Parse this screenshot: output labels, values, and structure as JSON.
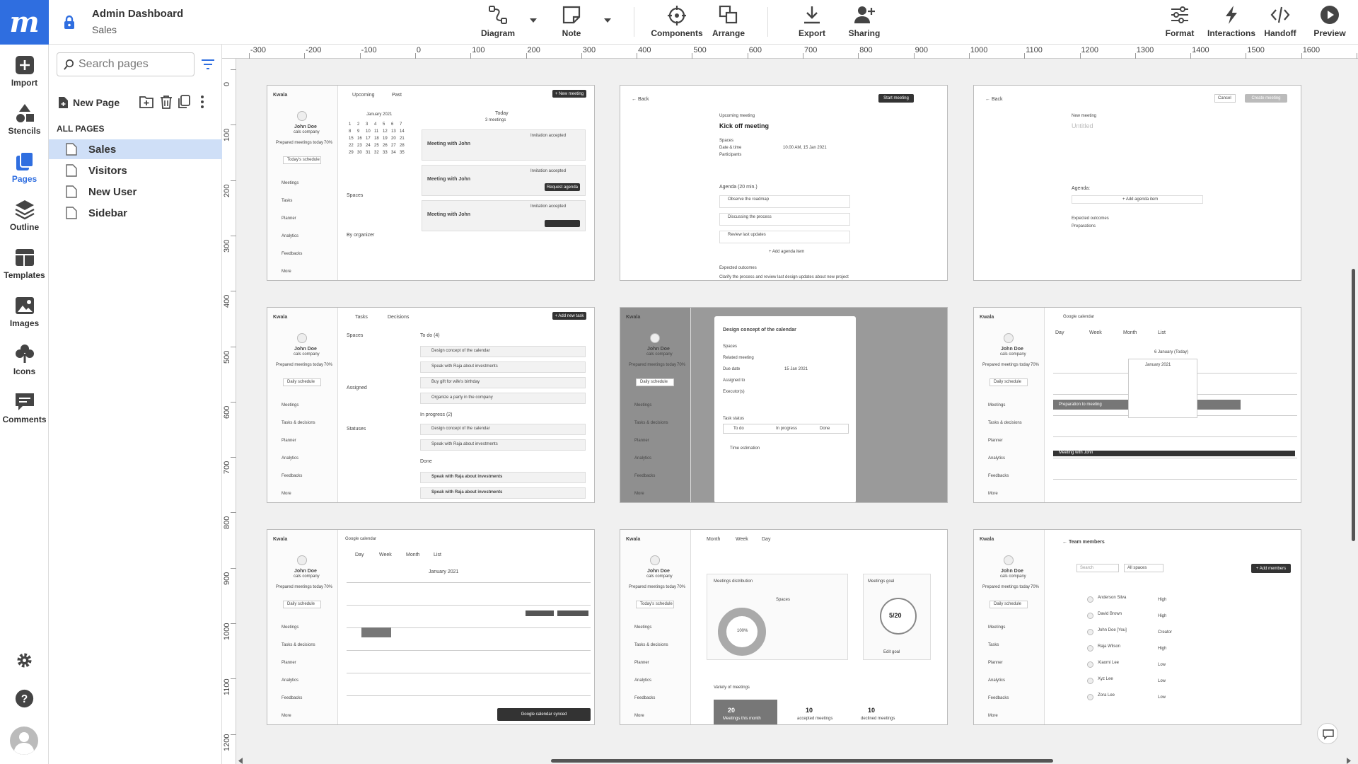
{
  "header": {
    "title": "Admin Dashboard",
    "subtitle": "Sales"
  },
  "toolbar": {
    "diagram": "Diagram",
    "note": "Note",
    "components": "Components",
    "arrange": "Arrange",
    "export": "Export",
    "sharing": "Sharing",
    "format": "Format",
    "interactions": "Interactions",
    "handoff": "Handoff",
    "preview": "Preview"
  },
  "rail": {
    "import": "Import",
    "stencils": "Stencils",
    "pages": "Pages",
    "outline": "Outline",
    "templates": "Templates",
    "images": "Images",
    "icons": "Icons",
    "comments": "Comments"
  },
  "panel": {
    "search_placeholder": "Search pages",
    "new_page": "New Page",
    "all_pages": "ALL PAGES",
    "pages": [
      "Sales",
      "Visitors",
      "New User",
      "Sidebar"
    ]
  },
  "ruler": {
    "h": [
      "-300",
      "-200",
      "-100",
      "0",
      "100",
      "200",
      "300",
      "400",
      "500",
      "600",
      "700",
      "800",
      "900",
      "1000",
      "1100",
      "1200",
      "1300",
      "1400",
      "1500",
      "1600",
      "1700"
    ],
    "v": [
      "0",
      "100",
      "200",
      "300",
      "400",
      "500",
      "600",
      "700",
      "800",
      "900",
      "1000",
      "1100",
      "1200"
    ]
  },
  "thumbs": {
    "app": "Kwala",
    "user": "John Doe",
    "company": "cals company",
    "prep": "Prepared meetings today",
    "pct": "70%",
    "today_sched": "Today's schedule",
    "daily_sched": "Daily schedule",
    "nav": [
      "Meetings",
      "Tasks",
      "Planner",
      "Analytics",
      "Feedbacks",
      "More"
    ],
    "nav2": [
      "Meetings",
      "Tasks & decisions",
      "Planner",
      "Analytics",
      "Feedbacks",
      "More"
    ],
    "t1": {
      "tab1": "Upcoming",
      "tab2": "Past",
      "btn": "+ New meeting",
      "month": "January 2021",
      "today": "Today",
      "count": "3 meetings",
      "spaces": "Spaces",
      "organizer": "By organizer",
      "m1": "Meeting with John",
      "m2": "Meeting with John",
      "m3": "Meeting with John",
      "req": "Request agenda",
      "acc": "Invitation accepted"
    },
    "t2": {
      "back": "Back",
      "start": "Start meeting",
      "upcoming": "Upcoming meeting",
      "title": "Kick off meeting",
      "spaces": "Spaces",
      "date": "Date & time",
      "date_val": "10.00 AM, 15 Jan 2021",
      "part": "Participants",
      "agenda": "Agenda (20 min.)",
      "a1": "Observe the roadmap",
      "a2": "Discussing the process",
      "a3": "Review last updates",
      "add": "+ Add agenda item",
      "exp": "Expected outcomes",
      "clar": "Clarify the process and review last design updates about new project"
    },
    "t3": {
      "back": "Back",
      "cancel": "Cancel",
      "create": "Create meeting",
      "new": "New meeting",
      "untitled": "Untitled",
      "agenda": "Agenda:",
      "add": "+ Add agenda item",
      "exp": "Expected outcomes",
      "prep": "Preparations"
    },
    "t4": {
      "tab1": "Tasks",
      "tab2": "Decisions",
      "btn": "+ Add new task",
      "todo": "To do (4)",
      "inprog": "In progress (2)",
      "done": "Done",
      "tasks": [
        "Design concept of the calendar",
        "Speak with Raja about investments",
        "Buy gift for wife's birthday",
        "Organize a party in the company"
      ],
      "prog": [
        "Design concept of the calendar",
        "Speak with Raja about investments"
      ],
      "dtasks": [
        "Speak with Raja about investments",
        "Speak with Raja about investments"
      ],
      "assigned": "Assigned",
      "statuses": "Statuses"
    },
    "t5": {
      "modal": "Design concept of the calendar",
      "spaces": "Spaces",
      "rel": "Related meeting",
      "due": "Due date",
      "due_val": "15 Jan 2021",
      "assn": "Assigned to",
      "exec": "Executor(s)",
      "status": "Task status",
      "s1": "To do",
      "s2": "In progress",
      "s3": "Done",
      "est": "Time estimation"
    },
    "t6": {
      "title": "Google calendar",
      "day": "Day",
      "week": "Week",
      "month": "Month",
      "list": "List",
      "date": "6 January (Today)",
      "cal_month": "January 2021",
      "ev1": "Preparation to meeting",
      "ev2": "Meeting with John"
    },
    "t7": {
      "title": "Google calendar",
      "day": "Day",
      "week": "Week",
      "month": "Month",
      "list": "List",
      "cal_month": "January 2021",
      "sync": "Google calendar synced"
    },
    "t8": {
      "month": "Month",
      "week": "Week",
      "day": "Day",
      "dist": "Meetings distribution",
      "goal": "Meetings goal",
      "goal_val": "5/20",
      "pct": "100%",
      "spaces": "Spaces",
      "variety": "Variety of meetings",
      "n1": "20",
      "n2": "10",
      "n3": "10",
      "l1": "Meetings this month",
      "l2": "accepted meetings",
      "l3": "declined meetings",
      "edit": "Edit goal"
    },
    "t9": {
      "title": "Team members",
      "btn": "+ Add members",
      "search": "Search",
      "filter": "All spaces",
      "members": [
        "Anderson Silva",
        "David Brown",
        "John Doe [You]",
        "Raja Wilson",
        "Xiaomi Lee",
        "Xyz Lee",
        "Zora Lee"
      ],
      "perm": [
        "High",
        "High",
        "Creator",
        "High",
        "Low",
        "Low",
        "Low"
      ]
    }
  }
}
